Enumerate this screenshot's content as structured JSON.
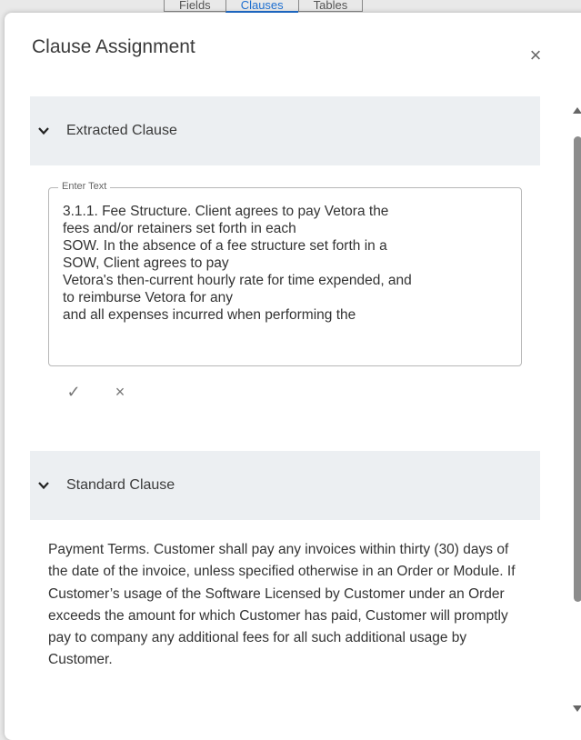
{
  "background_tabs": [
    "Fields",
    "Clauses",
    "Tables"
  ],
  "dialog": {
    "title": "Clause Assignment",
    "close_icon": "×"
  },
  "extracted": {
    "header": "Extracted Clause",
    "field_label": "Enter Text",
    "text": "3.1.1. Fee Structure. Client agrees to pay Vetora the\nfees and/or retainers set forth in each\nSOW. In the absence of a fee structure set forth in a\nSOW, Client agrees to pay\nVetora's then-current hourly rate for time expended, and\nto reimburse Vetora for any\nand all expenses incurred when performing the",
    "confirm_icon": "✓",
    "cancel_icon": "×"
  },
  "standard": {
    "header": "Standard Clause",
    "text": "Payment Terms. Customer shall pay any invoices within thirty (30) days of the date of the invoice, unless specified otherwise in an Order or Module. If Customer’s usage of the Software Licensed by Customer under an Order exceeds the amount for which Customer has paid, Customer will promptly pay to company any additional fees for all such additional usage by Customer."
  },
  "colors": {
    "accent": "#1e6fd0",
    "section_header_bg": "#eceff2",
    "scroll_thumb": "#8c8c8c"
  }
}
